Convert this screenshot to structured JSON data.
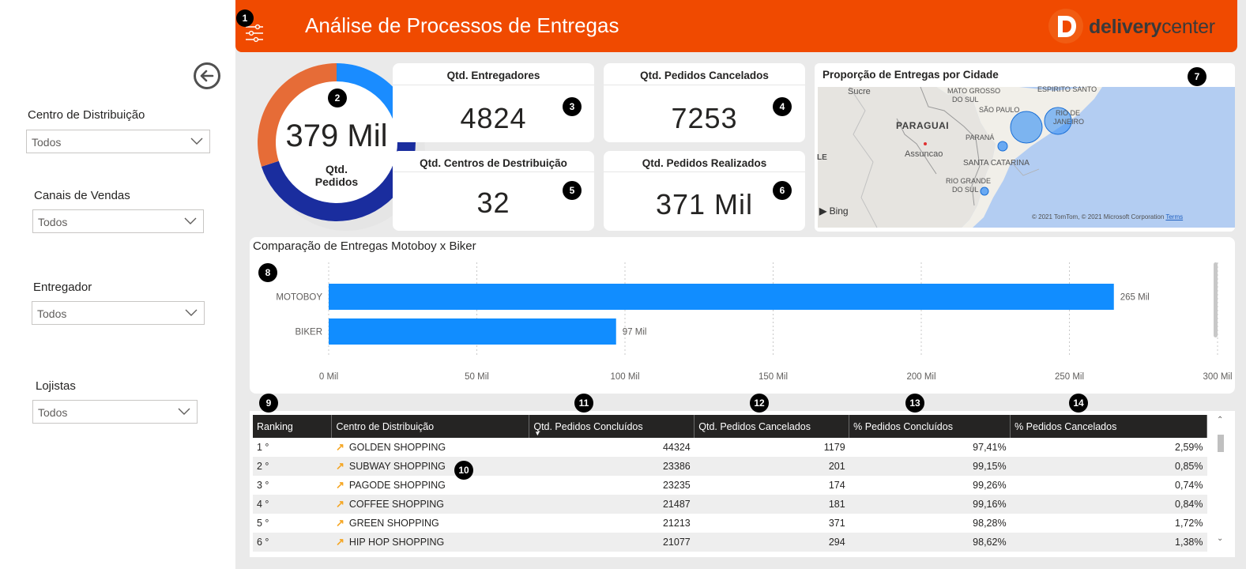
{
  "header": {
    "title": "Análise de Processos de Entregas",
    "logo": {
      "prefix": "delivery",
      "suffix": "center"
    }
  },
  "filters": [
    {
      "label": "Centro de Distribuição",
      "value": "Todos"
    },
    {
      "label": "Canais de Vendas",
      "value": "Todos"
    },
    {
      "label": "Entregador",
      "value": "Todos"
    },
    {
      "label": "Lojistas",
      "value": "Todos"
    }
  ],
  "badges": [
    "1",
    "2",
    "3",
    "4",
    "5",
    "6",
    "7",
    "8",
    "9",
    "10",
    "11",
    "12",
    "13",
    "14"
  ],
  "donut": {
    "value": "379 Mil",
    "label_line1": "Qtd.",
    "label_line2": "Pedidos",
    "colors": [
      "#1a8cff",
      "#1a2d9e",
      "#e66c37"
    ],
    "fractions": [
      0.25,
      0.45,
      0.3
    ]
  },
  "cards": [
    {
      "title": "Qtd. Entregadores",
      "value": "4824"
    },
    {
      "title": "Qtd. Pedidos Cancelados",
      "value": "7253"
    },
    {
      "title": "Qtd. Centros de Destribuição",
      "value": "32"
    },
    {
      "title": "Qtd. Pedidos Realizados",
      "value": "371 Mil"
    }
  ],
  "map": {
    "title": "Proporção de  Entregas por Cidade",
    "labels": [
      "Sucre",
      "MATO GROSSO",
      "DO SUL",
      "ESPIRITO SANTO",
      "SÃO PAULO",
      "RIO DE",
      "JANEIRO",
      "PARAGUAI",
      "PARANÁ",
      "Assuncao",
      "SANTA CATARINA",
      "RIO GRANDE",
      "DO SUL",
      "LE"
    ],
    "brand": "Bing",
    "copyright": "© 2021 TomTom, © 2021 Microsoft Corporation",
    "terms": "Terms"
  },
  "chart_data": {
    "type": "bar",
    "title": "Comparação de Entregas Motoboy x Biker",
    "categories": [
      "MOTOBOY",
      "BIKER"
    ],
    "values": [
      265,
      97
    ],
    "data_labels": [
      "265 Mil",
      "97 Mil"
    ],
    "xlim": [
      0,
      300
    ],
    "ticks": [
      0,
      50,
      100,
      150,
      200,
      250,
      300
    ],
    "tick_labels": [
      "0 Mil",
      "50 Mil",
      "100 Mil",
      "150 Mil",
      "200 Mil",
      "250 Mil",
      "300 Mil"
    ],
    "color": "#118dff",
    "grid": true
  },
  "table": {
    "columns": [
      "Ranking",
      "Centro de Distribuição",
      "Qtd. Pedidos Concluídos",
      "Qtd. Pedidos Cancelados",
      "% Pedidos Concluídos",
      "% Pedidos Cancelados"
    ],
    "rows": [
      [
        "1 °",
        "GOLDEN SHOPPING",
        "44324",
        "1179",
        "97,41%",
        "2,59%"
      ],
      [
        "2 °",
        "SUBWAY SHOPPING",
        "23386",
        "201",
        "99,15%",
        "0,85%"
      ],
      [
        "3 °",
        "PAGODE SHOPPING",
        "23235",
        "174",
        "99,26%",
        "0,74%"
      ],
      [
        "4 °",
        "COFFEE SHOPPING",
        "21487",
        "181",
        "99,16%",
        "0,84%"
      ],
      [
        "5 °",
        "GREEN SHOPPING",
        "21213",
        "371",
        "98,28%",
        "1,72%"
      ],
      [
        "6 °",
        "HIP HOP SHOPPING",
        "21077",
        "294",
        "98,62%",
        "1,38%"
      ]
    ]
  }
}
